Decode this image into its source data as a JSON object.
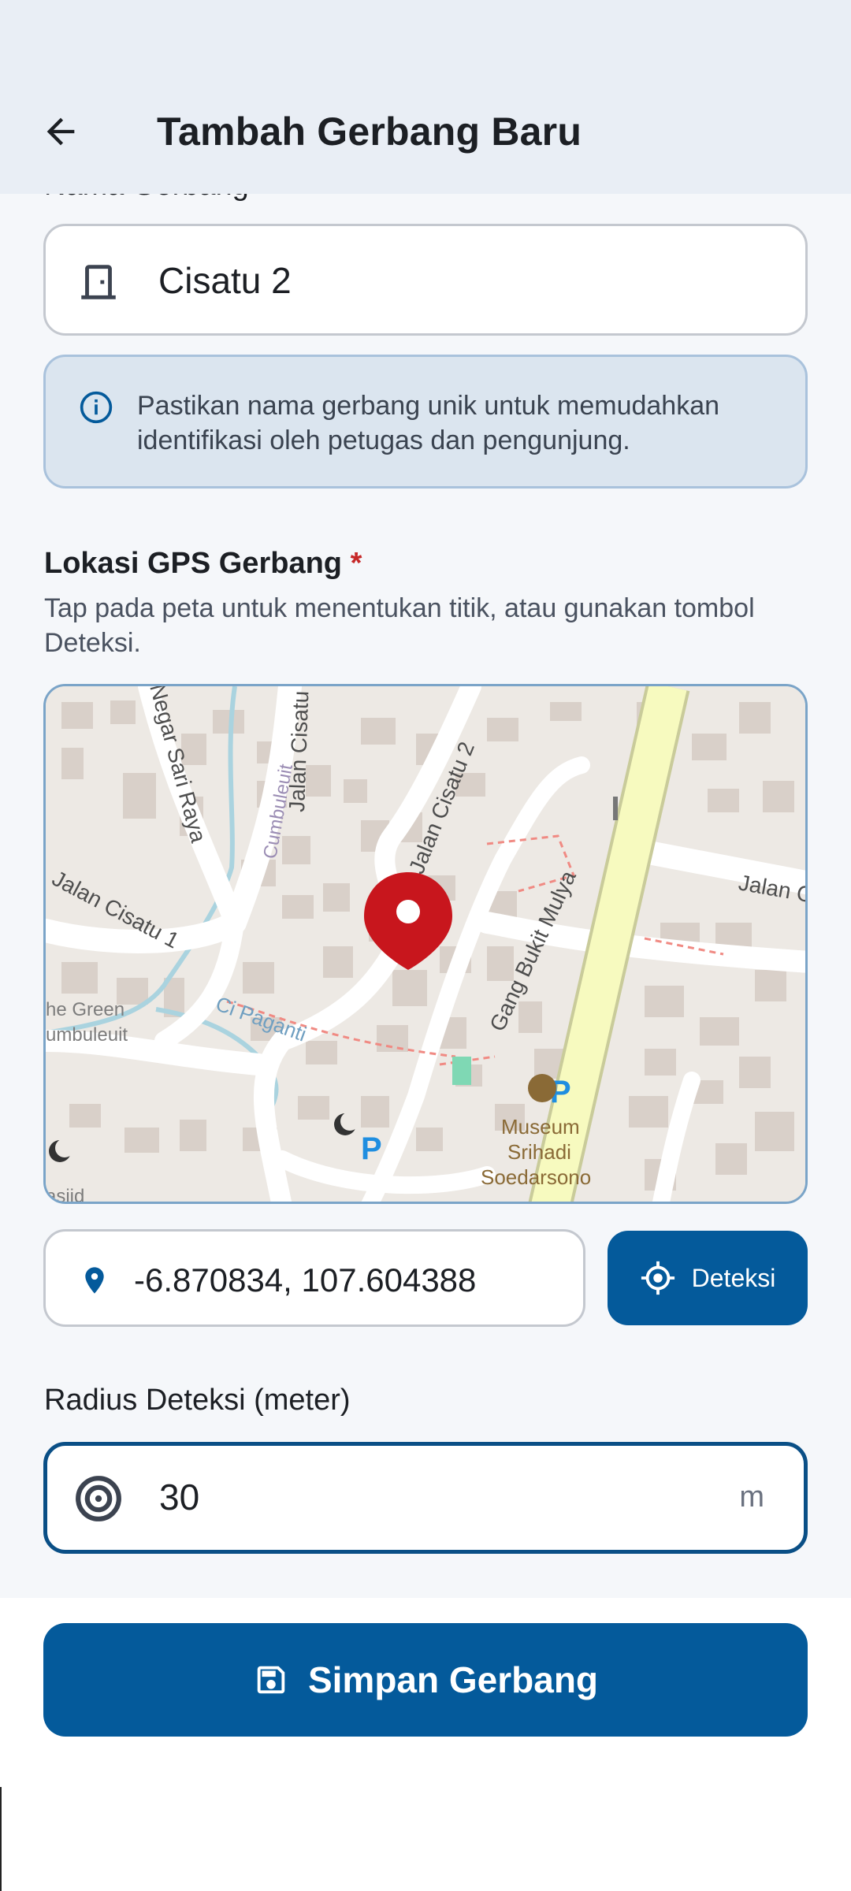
{
  "appbar": {
    "title": "Tambah Gerbang Baru",
    "back_icon": "arrow-left-icon"
  },
  "form": {
    "name_label": "Nama Gerbang",
    "name_value": "Cisatu 2",
    "name_icon": "door-icon",
    "info_text": "Pastikan nama gerbang unik untuk memudahkan identifikasi oleh petugas dan pengunjung.",
    "gps_title": "Lokasi GPS Gerbang",
    "required_mark": "*",
    "gps_subtitle": "Tap pada peta untuk menentukan titik, atau gunakan tombol Deteksi.",
    "coordinates": "-6.870834, 107.604388",
    "detect_label": "Deteksi",
    "radius_title": "Radius Deteksi (meter)",
    "radius_value": "30",
    "radius_unit": "m",
    "save_label": "Simpan Gerbang"
  },
  "map": {
    "labels": {
      "jalan_cisatu": "Jalan Cisatu",
      "jalan_cisatu_2": "Jalan Cisatu 2",
      "negar_sari_raya": "Negar Sari Raya",
      "jalan_cisatu_1": "Jalan Cisatu 1",
      "cumbuleuit": "Cumbuleuit",
      "green": "he Green",
      "umbuleuit": "umbuleuit",
      "ci_paganti": "Ci Paganti",
      "gang_bukit_mulya": "Gang Bukit Mulya",
      "jalan_c": "Jalan C",
      "museum_1": "Museum",
      "museum_2": "Srihadi",
      "museum_3": "Soedarsono",
      "masjid": "asjid",
      "parking": "P"
    },
    "colors": {
      "background": "#ede9e4",
      "building": "#d9d0c9",
      "road": "#ffffff",
      "main_road": "#f7fabf",
      "water": "#aad3df",
      "marker": "#c8161d"
    }
  }
}
